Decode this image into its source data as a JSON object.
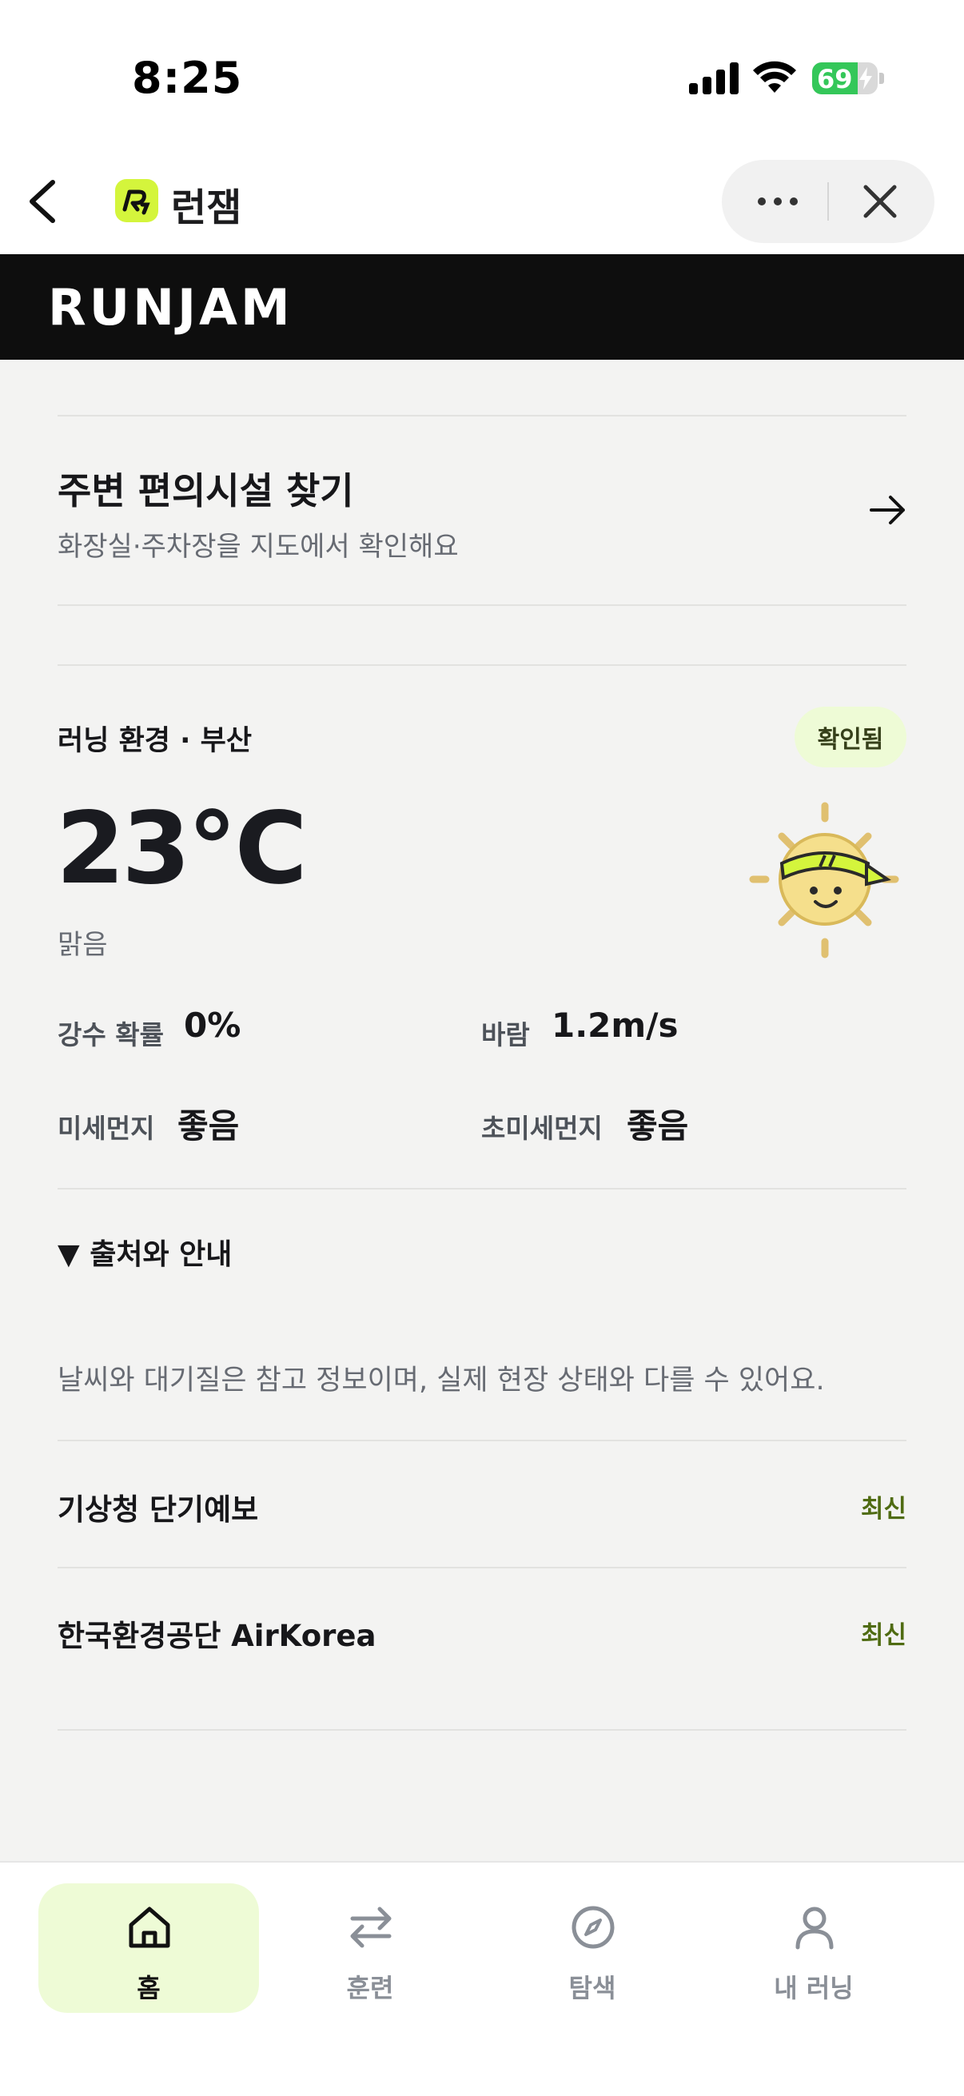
{
  "status_bar": {
    "time": "8:25",
    "battery_level": "69",
    "battery_fraction": 0.69
  },
  "header": {
    "app_name": "런잼",
    "brand_banner": "RUNJAM"
  },
  "facility": {
    "title": "주변 편의시설 찾기",
    "subtitle": "화장실·주차장을 지도에서 확인해요"
  },
  "weather": {
    "section_label": "러닝 환경 · 부산",
    "badge": "확인됨",
    "temperature": "23℃",
    "condition": "맑음",
    "metrics": [
      {
        "label": "강수 확률",
        "value": "0%"
      },
      {
        "label": "바람",
        "value": "1.2m/s"
      },
      {
        "label": "미세먼지",
        "value": "좋음"
      },
      {
        "label": "초미세먼지",
        "value": "좋음"
      }
    ]
  },
  "sources": {
    "toggle_label": "▼ 출처와 안내",
    "disclaimer": "날씨와 대기질은 참고 정보이며, 실제 현장 상태와 다를 수 있어요.",
    "items": [
      {
        "name": "기상청 단기예보",
        "status": "최신"
      },
      {
        "name": "한국환경공단 AirKorea",
        "status": "최신"
      }
    ]
  },
  "tabs": [
    {
      "label": "홈",
      "icon": "home-icon",
      "active": true
    },
    {
      "label": "훈련",
      "icon": "swap-arrows-icon",
      "active": false
    },
    {
      "label": "탐색",
      "icon": "compass-icon",
      "active": false
    },
    {
      "label": "내 러닝",
      "icon": "person-icon",
      "active": false
    }
  ],
  "colors": {
    "accent": "#d4f53c",
    "badge_bg": "#eefbd6",
    "banner_bg": "#0e0e0e",
    "status_green": "#4f6b12"
  }
}
